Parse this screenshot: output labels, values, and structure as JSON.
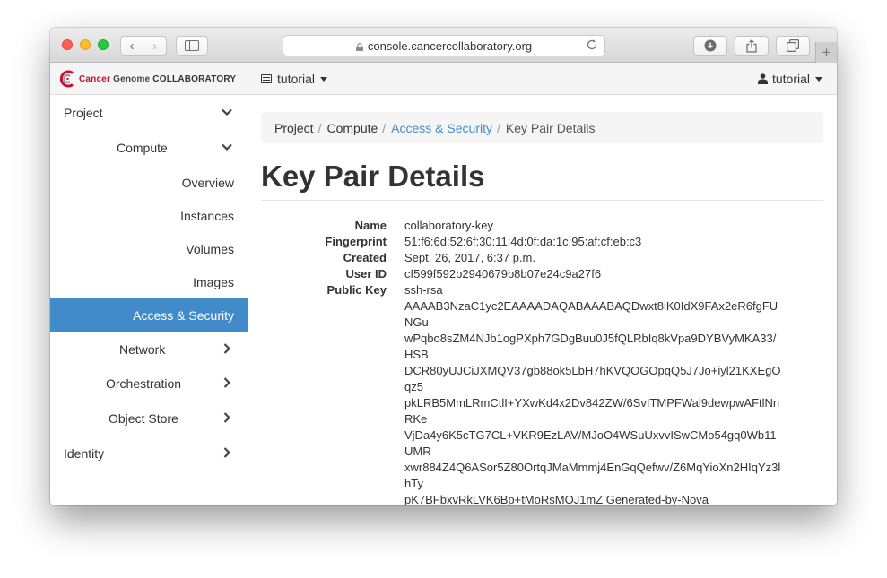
{
  "browser": {
    "url": "console.cancercollaboratory.org"
  },
  "brand": {
    "part1": "Cancer",
    "part2": "Genome",
    "part3": "COLLABORATORY"
  },
  "header": {
    "project": "tutorial",
    "user": "tutorial"
  },
  "sidebar": {
    "project": "Project",
    "compute": "Compute",
    "overview": "Overview",
    "instances": "Instances",
    "volumes": "Volumes",
    "images": "Images",
    "access_security": "Access & Security",
    "network": "Network",
    "orchestration": "Orchestration",
    "object_store": "Object Store",
    "identity": "Identity"
  },
  "breadcrumb": {
    "items": [
      "Project",
      "Compute",
      "Access & Security",
      "Key Pair Details"
    ]
  },
  "page": {
    "title": "Key Pair Details"
  },
  "details": {
    "name_label": "Name",
    "name": "collaboratory-key",
    "fingerprint_label": "Fingerprint",
    "fingerprint": "51:f6:6d:52:6f:30:11:4d:0f:da:1c:95:af:cf:eb:c3",
    "created_label": "Created",
    "created": "Sept. 26, 2017, 6:37 p.m.",
    "userid_label": "User ID",
    "userid": "cf599f592b2940679b8b07e24c9a27f6",
    "pubkey_label": "Public Key",
    "pubkey_lines": [
      "ssh-rsa",
      "AAAAB3NzaC1yc2EAAAADAQABAAABAQDwxt8iK0IdX9FAx2eR6fgFUNGu",
      "wPqbo8sZM4NJb1ogPXph7GDgBuu0J5fQLRbIq8kVpa9DYBVyMKA33/HSB",
      "DCR80yUJCiJXMQV37gb88ok5LbH7hKVQOGOpqQ5J7Jo+iyl21KXEgOqz5",
      "pkLRB5MmLRmCtlI+YXwKd4x2Dv842ZW/6SvITMPFWal9dewpwAFtlNnRKe",
      "VjDa4y6K5cTG7CL+VKR9EzLAV/MJoO4WSuUxvvISwCMo54gq0Wb11UMR",
      "xwr884Z4Q6ASor5Z80OrtqJMaMmmj4EnGqQefwv/Z6MqYioXn2HIqYz3lhTy",
      "pK7BFbxvRkLVK6Bp+tMoRsMOJ1mZ Generated-by-Nova"
    ]
  }
}
